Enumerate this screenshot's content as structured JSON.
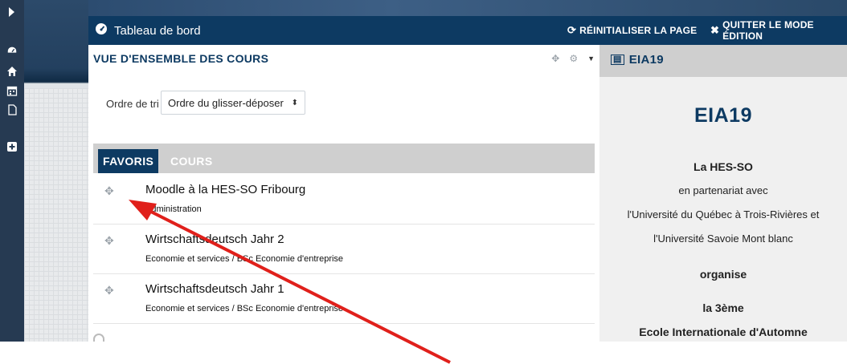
{
  "header": {
    "title": "Tableau de bord",
    "reset_label": "RÉINITIALISER LA PAGE",
    "quit_label": "QUITTER LE MODE ÉDITION"
  },
  "block": {
    "title": "VUE D'ENSEMBLE DES COURS",
    "sort_label": "Ordre de tri",
    "sort_value": "Ordre du glisser-déposer",
    "tabs": [
      {
        "label": "FAVORIS",
        "active": true
      },
      {
        "label": "COURS",
        "active": false
      }
    ],
    "courses": [
      {
        "title": "Moodle à la HES-SO Fribourg",
        "category": "Administration"
      },
      {
        "title": "Wirtschaftsdeutsch Jahr 2",
        "category": "Economie et services / BSc Economie d'entreprise"
      },
      {
        "title": "Wirtschaftsdeutsch Jahr 1",
        "category": "Economie et services / BSc Economie d'entreprise"
      }
    ]
  },
  "right_panel": {
    "header_title": "EIA19",
    "big_title": "EIA19",
    "lines": [
      "La HES-SO",
      "en partenariat avec",
      "l'Université du Québec à Trois-Rivières et",
      "l'Université Savoie Mont blanc",
      "organise",
      "la 3ème",
      "Ecole Internationale d'Automne"
    ]
  },
  "colors": {
    "brand_navy": "#0d3a62",
    "sidebar": "#263a52",
    "arrow": "#e0201b"
  },
  "icons": [
    "dashboard-icon",
    "home-icon",
    "calendar-icon",
    "file-icon",
    "plus-square-icon",
    "move-icon",
    "gear-icon",
    "refresh-icon",
    "close-icon",
    "newspaper-icon"
  ]
}
